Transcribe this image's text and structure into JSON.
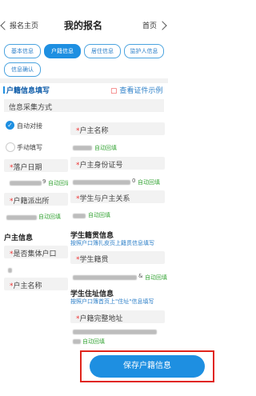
{
  "header": {
    "back_label": "报名主页",
    "title": "我的报名",
    "home_label": "首页"
  },
  "tabs": [
    {
      "label": "基本信息"
    },
    {
      "label": "户籍信息"
    },
    {
      "label": "居住信息"
    },
    {
      "label": "监护人信息"
    },
    {
      "label": "信息确认"
    }
  ],
  "left": {
    "section_title": "户籍信息填写",
    "example_link": "查看证件示例",
    "collect_method": "信息采集方式",
    "auto_label": "自动对接",
    "manual_label": "手动填写",
    "settle_date_label": "落户日期",
    "settle_date_tail": "9",
    "auto_fill": "自动回填",
    "police_label": "户籍派出所",
    "owner_section": "户主信息",
    "collective_label": "是否集体户口",
    "owner_name_label": "户主名称"
  },
  "right": {
    "owner_name_label": "户主名称",
    "owner_id_label": "户主身份证号",
    "owner_id_tail": "0",
    "relation_label": "学生与户主关系",
    "auto_fill": "自动回填",
    "native_title": "学生籍贯信息",
    "native_note": "按照户口簿扎皮页上籍贯信息填写",
    "native_label": "学生籍贯",
    "native_tail": "&",
    "address_title": "学生住址信息",
    "address_note": "按照户口簿首页上\"住址\"信息填写",
    "address_label": "户籍完整地址"
  },
  "save_button": "保存户籍信息",
  "colors": {
    "primary": "#1e8fe1",
    "highlight": "#e0251c",
    "required": "#e33333",
    "autofill": "#3aa63a"
  }
}
